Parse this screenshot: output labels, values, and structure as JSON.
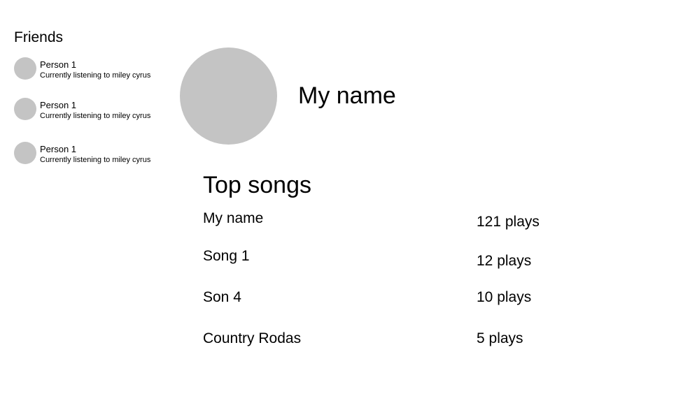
{
  "friends": {
    "title": "Friends",
    "items": [
      {
        "name": "Person 1",
        "status": "Currently listening to miley cyrus"
      },
      {
        "name": "Person 1",
        "status": "Currently listening to miley cyrus"
      },
      {
        "name": "Person 1",
        "status": "Currently listening to miley cyrus"
      }
    ]
  },
  "profile": {
    "name": "My name"
  },
  "top_songs": {
    "title": "Top songs",
    "items": [
      {
        "name": "My name",
        "plays": "121 plays"
      },
      {
        "name": "Song 1",
        "plays": "12 plays"
      },
      {
        "name": "Son 4",
        "plays": "10 plays"
      },
      {
        "name": "Country Rodas",
        "plays": "5 plays"
      }
    ]
  },
  "colors": {
    "avatar_placeholder": "#c4c4c4",
    "text": "#000000",
    "background": "#ffffff"
  }
}
